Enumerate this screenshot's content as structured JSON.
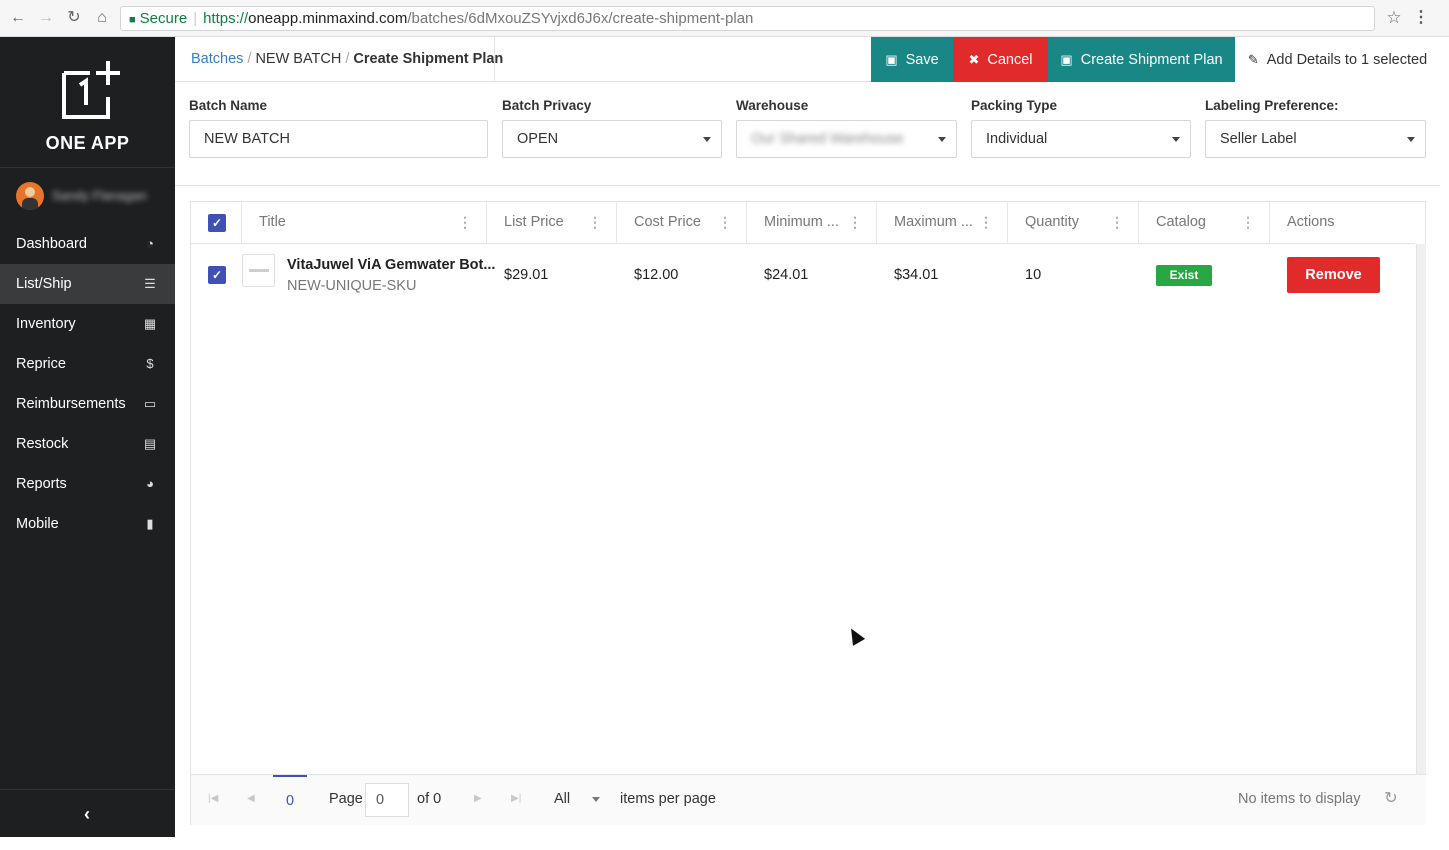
{
  "browser": {
    "secure_label": "Secure",
    "url_scheme": "https://",
    "url_host": "oneapp.minmaxind.com",
    "url_path": "/batches/6dMxouZSYvjxd6J6x/create-shipment-plan"
  },
  "app": {
    "logo_text": "ONE APP",
    "user_name": "Sandy Flanagan"
  },
  "sidebar": {
    "items": [
      {
        "label": "Dashboard",
        "icon": "dashboard-icon",
        "glyph": "◔"
      },
      {
        "label": "List/Ship",
        "icon": "list-icon",
        "glyph": "☰"
      },
      {
        "label": "Inventory",
        "icon": "grid-icon",
        "glyph": "▦"
      },
      {
        "label": "Reprice",
        "icon": "dollar-icon",
        "glyph": "$"
      },
      {
        "label": "Reimbursements",
        "icon": "money-icon",
        "glyph": "▭"
      },
      {
        "label": "Restock",
        "icon": "table-icon",
        "glyph": "▤"
      },
      {
        "label": "Reports",
        "icon": "pie-chart-icon",
        "glyph": "◕"
      },
      {
        "label": "Mobile",
        "icon": "mobile-icon",
        "glyph": "▮"
      }
    ],
    "active_index": 1,
    "collapse_glyph": "‹"
  },
  "breadcrumb": {
    "root": "Batches",
    "batch": "NEW BATCH",
    "current": "Create Shipment Plan",
    "separator": "/"
  },
  "toolbar": {
    "save_label": "Save",
    "cancel_label": "Cancel",
    "create_label": "Create Shipment Plan",
    "add_details_label": "Add Details to 1 selected"
  },
  "form": {
    "batch_name_label": "Batch Name",
    "batch_name_value": "NEW BATCH",
    "privacy_label": "Batch Privacy",
    "privacy_value": "OPEN",
    "warehouse_label": "Warehouse",
    "warehouse_value": "Our Shared Warehouse",
    "packing_label": "Packing Type",
    "packing_value": "Individual",
    "labeling_label": "Labeling Preference:",
    "labeling_value": "Seller Label"
  },
  "grid": {
    "columns": [
      "Title",
      "List Price",
      "Cost Price",
      "Minimum ...",
      "Maximum ...",
      "Quantity",
      "Catalog",
      "Actions"
    ],
    "rows": [
      {
        "title": "VitaJuwel ViA Gemwater Bot...",
        "sku": "NEW-UNIQUE-SKU",
        "list_price": "$29.01",
        "cost_price": "$12.00",
        "minimum": "$24.01",
        "maximum": "$34.01",
        "quantity": "10",
        "catalog": "Exist",
        "action": "Remove"
      }
    ]
  },
  "pager": {
    "current_page": "0",
    "page_label": "Page",
    "page_input": "0",
    "of_label": "of 0",
    "per_page_value": "All",
    "per_page_label": "items per page",
    "status": "No items to display"
  },
  "colors": {
    "teal": "#1a8787",
    "red": "#e12a2a",
    "green": "#28a745",
    "indigo": "#3f51b5",
    "sidebar_bg": "#1e1f20"
  }
}
